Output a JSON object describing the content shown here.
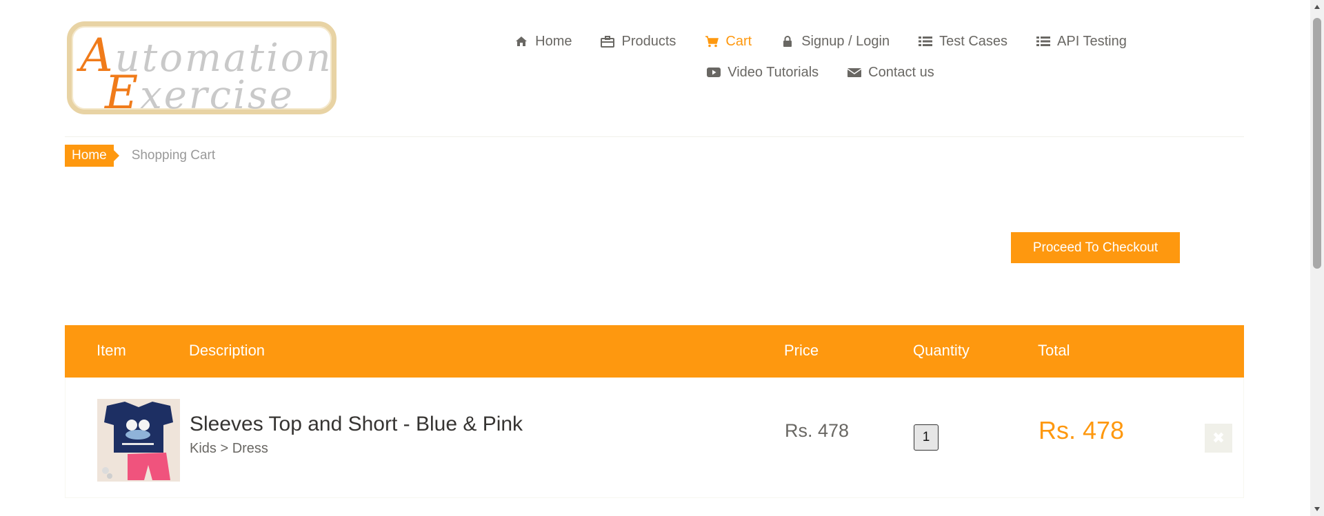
{
  "logo": {
    "line1_cap": "A",
    "line1_rest": "utomation",
    "line2_cap": "E",
    "line2_rest": "xercise"
  },
  "nav": {
    "row1": [
      {
        "label": "Home",
        "icon": "home-icon"
      },
      {
        "label": "Products",
        "icon": "products-icon"
      },
      {
        "label": "Cart",
        "icon": "cart-icon",
        "active": true
      },
      {
        "label": "Signup / Login",
        "icon": "lock-icon"
      },
      {
        "label": "Test Cases",
        "icon": "list-icon"
      },
      {
        "label": "API Testing",
        "icon": "list-icon"
      }
    ],
    "row2": [
      {
        "label": "Video Tutorials",
        "icon": "youtube-icon"
      },
      {
        "label": "Contact us",
        "icon": "envelope-icon"
      }
    ]
  },
  "breadcrumb": {
    "home": "Home",
    "current": "Shopping Cart"
  },
  "checkout": {
    "label": "Proceed To Checkout"
  },
  "cart": {
    "headers": {
      "item": "Item",
      "description": "Description",
      "price": "Price",
      "quantity": "Quantity",
      "total": "Total"
    },
    "rows": [
      {
        "name": "Sleeves Top and Short - Blue & Pink",
        "category": "Kids > Dress",
        "price": "Rs. 478",
        "quantity": "1",
        "total": "Rs. 478",
        "delete_icon": "close-icon"
      }
    ]
  },
  "colors": {
    "accent": "#fe980f",
    "text": "#696763",
    "dark_text": "#363432"
  }
}
